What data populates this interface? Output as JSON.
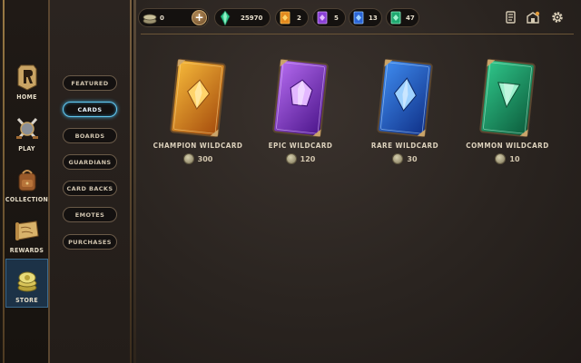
{
  "left_nav": {
    "items": [
      {
        "label": "HOME",
        "icon": "legends-logo-icon"
      },
      {
        "label": "PLAY",
        "icon": "crossed-swords-icon"
      },
      {
        "label": "COLLECTION",
        "icon": "backpack-icon"
      },
      {
        "label": "REWARDS",
        "icon": "scroll-map-icon"
      },
      {
        "label": "STORE",
        "icon": "coin-stack-icon"
      }
    ],
    "active": "STORE"
  },
  "sub_nav": {
    "items": [
      "FEATURED",
      "CARDS",
      "BOARDS",
      "GUARDIANS",
      "CARD BACKS",
      "EMOTES",
      "PURCHASES"
    ],
    "active": "CARDS"
  },
  "currency_bar": {
    "coins": "0",
    "shards": "25970",
    "wildcards": {
      "champion": "2",
      "epic": "5",
      "rare": "13",
      "common": "47"
    },
    "right_icons": [
      "deck-icon",
      "shop-lock-icon",
      "settings-gear-icon"
    ]
  },
  "wildcards": [
    {
      "name": "CHAMPION WILDCARD",
      "price": "300",
      "color_light": "#f6b93a",
      "color_dark": "#a44a0c",
      "gem": "#ffd46a"
    },
    {
      "name": "EPIC WILDCARD",
      "price": "120",
      "color_light": "#b56bf0",
      "color_dark": "#4a1489",
      "gem": "#e3b8ff"
    },
    {
      "name": "RARE WILDCARD",
      "price": "30",
      "color_light": "#3f8cf0",
      "color_dark": "#0f2f86",
      "gem": "#9fd2ff"
    },
    {
      "name": "COMMON WILDCARD",
      "price": "10",
      "color_light": "#2fc68a",
      "color_dark": "#0c5b3b",
      "gem": "#9ef1cd"
    }
  ],
  "colors": {
    "accent_blue": "#63c8ef",
    "gold_trim": "#9a7a44",
    "background": "#1b1714"
  }
}
